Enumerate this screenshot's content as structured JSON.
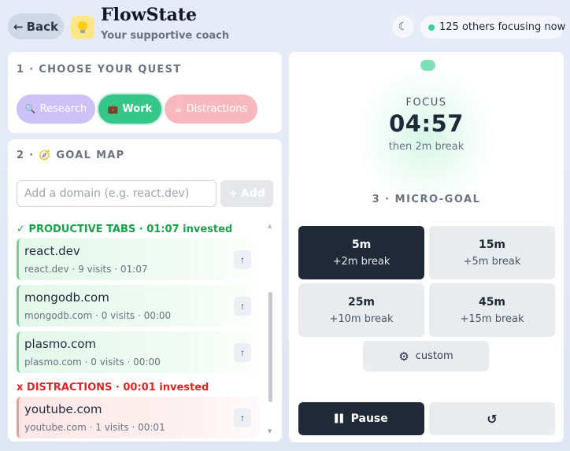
{
  "header": {
    "back_label": "Back",
    "back_icon": "arrow-left-icon",
    "logo_icon": "lightbulb-icon",
    "title": "FlowState",
    "subtitle": "Your supportive coach",
    "theme_icon": "moon-icon",
    "presence_text": "125 others focusing now"
  },
  "quest": {
    "title": "1 · CHOOSE YOUR QUEST",
    "options": [
      {
        "label": "Research",
        "icon": "magnifier-icon",
        "selected": false
      },
      {
        "label": "Work",
        "icon": "briefcase-icon",
        "selected": true
      },
      {
        "label": "Distractions",
        "icon": "coffee-icon",
        "selected": false
      }
    ]
  },
  "goal_map": {
    "title_prefix": "2 ·",
    "title": "GOAL MAP",
    "input_placeholder": "Add a domain (e.g. react.dev)",
    "add_label": "Add",
    "productive": {
      "heading": "✓ PRODUCTIVE TABS · 01:07 invested",
      "sites": [
        {
          "name": "react.dev",
          "meta": "react.dev · 9 visits · 01:07"
        },
        {
          "name": "mongodb.com",
          "meta": "mongodb.com · 0 visits · 00:00"
        },
        {
          "name": "plasmo.com",
          "meta": "plasmo.com · 0 visits · 00:00"
        }
      ]
    },
    "distractions": {
      "heading": "x DISTRACTIONS · 00:01 invested",
      "sites": [
        {
          "name": "youtube.com",
          "meta": "youtube.com · 1 visits · 00:01"
        }
      ]
    }
  },
  "timer": {
    "mode_label": "FOCUS",
    "time": "04:57",
    "break_note": "then 2m break",
    "micro_goal_title": "3 · MICRO-GOAL",
    "options": [
      {
        "duration": "5m",
        "break": "+2m break",
        "selected": true
      },
      {
        "duration": "15m",
        "break": "+5m break",
        "selected": false
      },
      {
        "duration": "25m",
        "break": "+10m break",
        "selected": false
      },
      {
        "duration": "45m",
        "break": "+15m break",
        "selected": false
      }
    ],
    "custom_label": "custom",
    "pause_label": "Pause",
    "reset_icon": "reset-icon"
  },
  "colors": {
    "accent_green": "#34c789",
    "productive_green": "#16a34a",
    "distraction_red": "#dc2626",
    "dark": "#1f2937"
  }
}
